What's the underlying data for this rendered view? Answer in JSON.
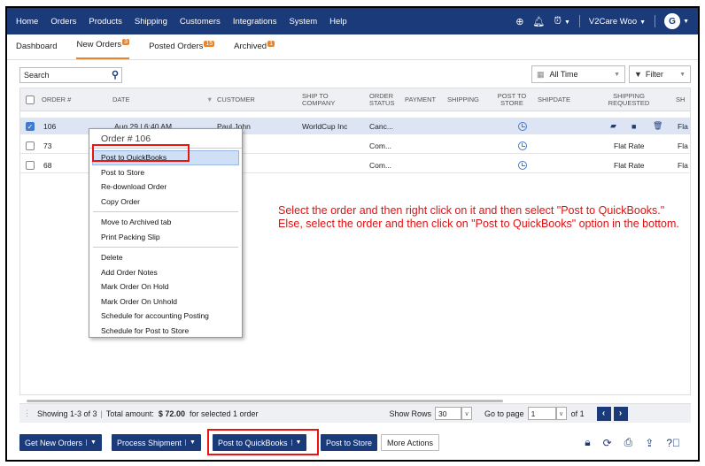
{
  "nav": {
    "items": [
      "Home",
      "Orders",
      "Products",
      "Shipping",
      "Customers",
      "Integrations",
      "System",
      "Help"
    ],
    "account": "V2Care Woo",
    "avatar_letter": "G"
  },
  "subtabs": [
    {
      "label": "Dashboard",
      "badge": ""
    },
    {
      "label": "New Orders",
      "badge": "3"
    },
    {
      "label": "Posted Orders",
      "badge": "15"
    },
    {
      "label": "Archived",
      "badge": "1"
    }
  ],
  "toolbar": {
    "search_value": "Search",
    "date_range": "All Time",
    "filter_label": "Filter"
  },
  "table": {
    "headers": {
      "order": "ORDER #",
      "date": "DATE",
      "customer": "CUSTOMER",
      "ship_to": "SHIP TO COMPANY",
      "status": "ORDER STATUS",
      "payment": "PAYMENT",
      "shipping": "SHIPPING",
      "post_to_store": "POST TO STORE",
      "shipdate": "SHIPDATE",
      "shipping_requested": "SHIPPING REQUESTED",
      "sh_cut": "SH"
    },
    "rows": [
      {
        "order": "106",
        "date": "Aug 29 | 6:40 AM",
        "customer": "Paul John",
        "ship_to": "WorldCup Inc",
        "status": "Canc...",
        "shipreq": "",
        "sh_cut": "Fla",
        "selected": true
      },
      {
        "order": "73",
        "date": "",
        "customer": "",
        "ship_to": "",
        "status": "Com...",
        "shipreq": "Flat Rate",
        "sh_cut": "Fla",
        "selected": false
      },
      {
        "order": "68",
        "date": "",
        "customer": "",
        "ship_to": "",
        "status": "Com...",
        "shipreq": "Flat Rate",
        "sh_cut": "Fla",
        "selected": false
      }
    ]
  },
  "context_menu": {
    "title": "Order # 106",
    "groups": [
      [
        "Post to QuickBooks",
        "Post to Store",
        "Re-download Order",
        "Copy Order"
      ],
      [
        "Move to Archived tab",
        "Print Packing Slip"
      ],
      [
        "Delete",
        "Add Order Notes",
        "Mark Order On Hold",
        "Mark Order On Unhold",
        "Schedule for accounting Posting",
        "Schedule for Post to Store"
      ]
    ]
  },
  "instruction": {
    "line1": "Select the order and then right click on it and then select \"Post to QuickBooks.\"",
    "line2": "Else, select the order and then click on \"Post to QuickBooks\" option in the bottom."
  },
  "status": {
    "showing": "Showing 1-3 of 3",
    "total_label": "Total amount:",
    "total_value": "$ 72.00",
    "total_suffix": "for selected 1 order",
    "show_rows_label": "Show Rows",
    "rows_value": "30",
    "goto_label": "Go to page",
    "page_value": "1",
    "of_label": "of 1"
  },
  "actions": {
    "get_new_orders": "Get New Orders",
    "process_shipment": "Process Shipment",
    "post_to_quickbooks": "Post to QuickBooks",
    "post_to_store": "Post to Store",
    "more_actions": "More Actions"
  },
  "colors": {
    "navy": "#1b3a7a",
    "accent_orange": "#e8842e",
    "annotation_red": "#e01010"
  }
}
